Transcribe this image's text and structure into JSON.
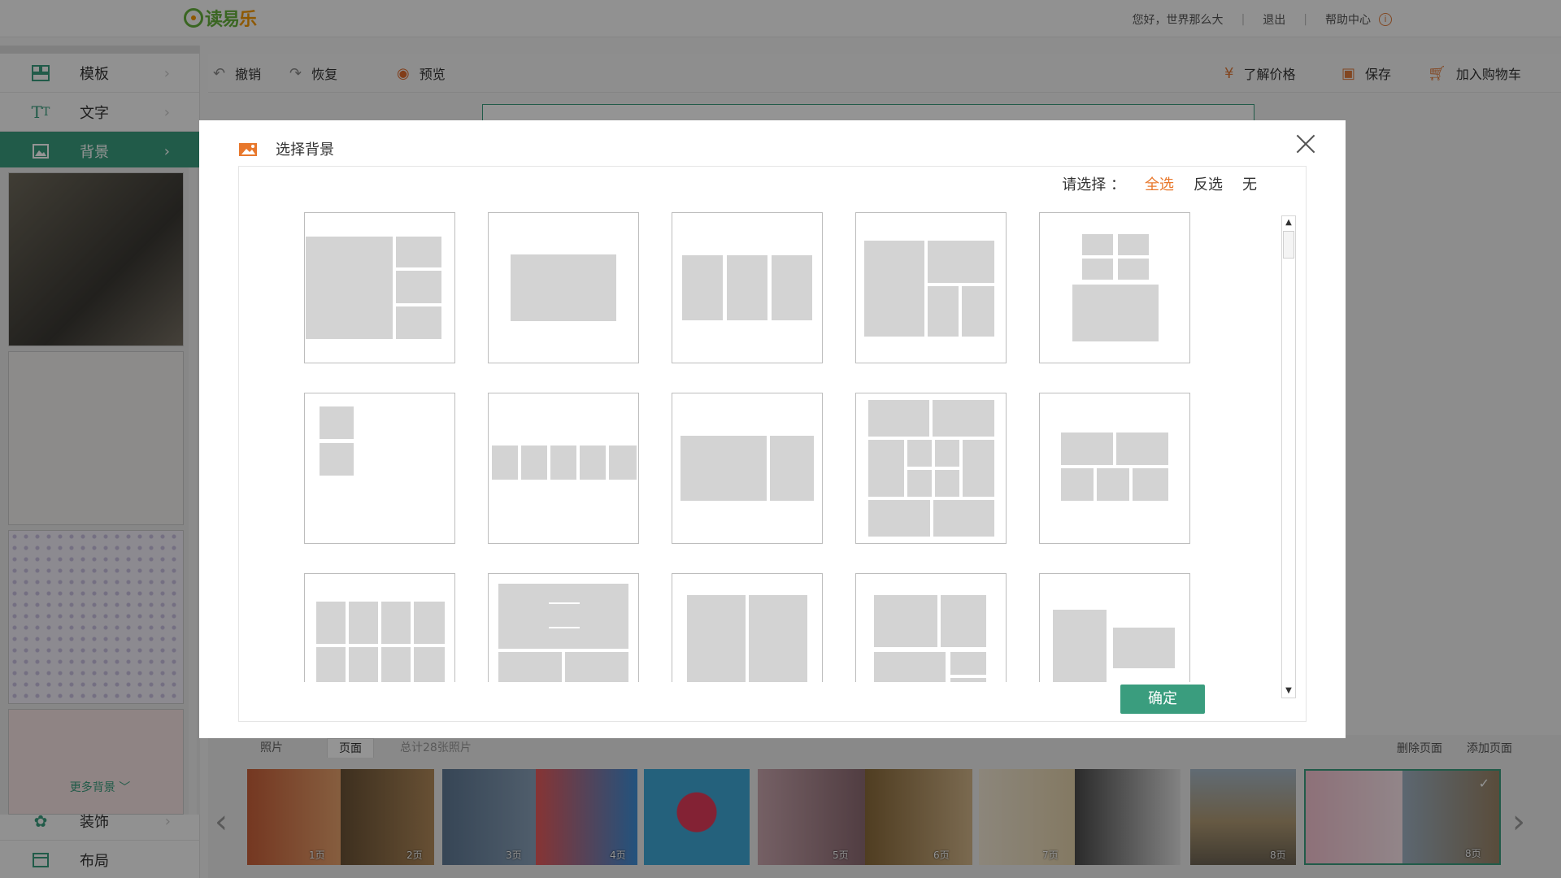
{
  "logo": {
    "text_main": "读易",
    "text_le": "乐"
  },
  "top": {
    "greeting": "您好，世界那么大",
    "logout": "退出",
    "help": "帮助中心",
    "sep": "|"
  },
  "sidebar": {
    "items": [
      {
        "label": "模板",
        "icon": "template-icon"
      },
      {
        "label": "文字",
        "icon": "text-icon"
      },
      {
        "label": "背景",
        "icon": "image-icon"
      }
    ],
    "more_bg": "更多背景",
    "bottom_items": [
      {
        "label": "装饰",
        "icon": "decoration-icon"
      },
      {
        "label": "布局",
        "icon": "layout-icon"
      }
    ]
  },
  "toolbar": {
    "undo": "撤销",
    "redo": "恢复",
    "preview": "预览",
    "price": "了解价格",
    "save": "保存",
    "cart": "加入购物车"
  },
  "bottom": {
    "tabs": [
      "照片",
      "页面"
    ],
    "total": "总计28张照片",
    "delete_page": "删除页面",
    "add_page": "添加页面",
    "pages": [
      "1页",
      "2页",
      "3页",
      "4页",
      "5页",
      "6页",
      "7页",
      "8页",
      "8页"
    ]
  },
  "modal": {
    "title": "选择背景",
    "select_label": "请选择 ：",
    "select_all": "全选",
    "invert": "反选",
    "none": "无",
    "confirm": "确定"
  },
  "colors": {
    "accent": "#3a9d7e",
    "orange": "#e8782c",
    "placeholder": "#d3d3d3"
  }
}
